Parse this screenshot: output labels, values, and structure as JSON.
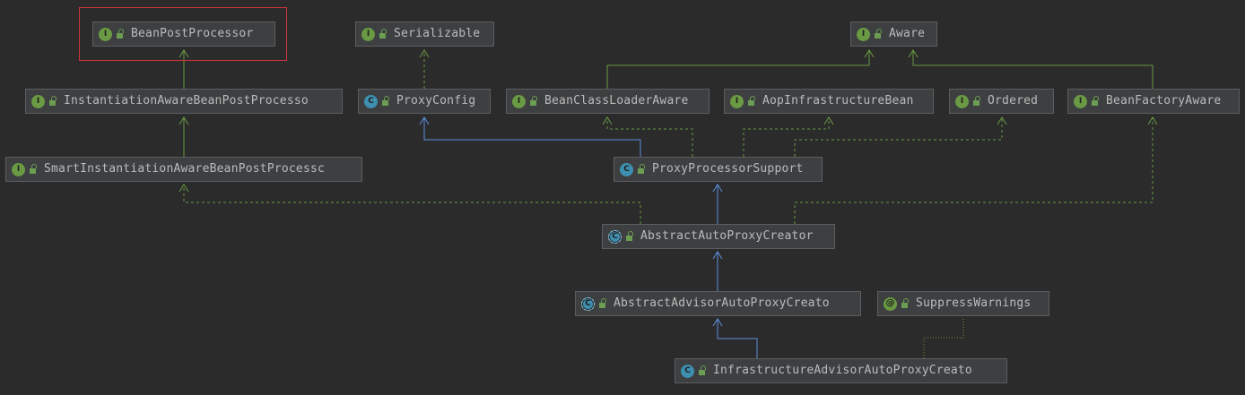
{
  "diagram": {
    "nodes": {
      "bean_post_processor": {
        "label": "BeanPostProcessor",
        "kind": "interface",
        "icon": "I"
      },
      "serializable": {
        "label": "Serializable",
        "kind": "interface",
        "icon": "I"
      },
      "aware": {
        "label": "Aware",
        "kind": "interface",
        "icon": "I"
      },
      "instantiation_aware": {
        "label": "InstantiationAwareBeanPostProcesso",
        "kind": "interface",
        "icon": "I"
      },
      "proxy_config": {
        "label": "ProxyConfig",
        "kind": "class",
        "icon": "C"
      },
      "bean_class_loader_aware": {
        "label": "BeanClassLoaderAware",
        "kind": "interface",
        "icon": "I"
      },
      "aop_infrastructure_bean": {
        "label": "AopInfrastructureBean",
        "kind": "interface",
        "icon": "I"
      },
      "ordered": {
        "label": "Ordered",
        "kind": "interface",
        "icon": "I"
      },
      "bean_factory_aware": {
        "label": "BeanFactoryAware",
        "kind": "interface",
        "icon": "I"
      },
      "smart_instantiation_aware": {
        "label": "SmartInstantiationAwareBeanPostProcessc",
        "kind": "interface",
        "icon": "I"
      },
      "proxy_processor_support": {
        "label": "ProxyProcessorSupport",
        "kind": "class",
        "icon": "C"
      },
      "abstract_auto_proxy_creator": {
        "label": "AbstractAutoProxyCreator",
        "kind": "abstract",
        "icon": "C"
      },
      "abstract_advisor_auto_proxy_creator": {
        "label": "AbstractAdvisorAutoProxyCreato",
        "kind": "abstract",
        "icon": "C"
      },
      "suppress_warnings": {
        "label": "SuppressWarnings",
        "kind": "annotation",
        "icon": "@"
      },
      "infrastructure_advisor_auto_proxy_creator": {
        "label": "InfrastructureAdvisorAutoProxyCreato",
        "kind": "class",
        "icon": "C"
      }
    },
    "colors": {
      "background": "#2b2b2b",
      "extends": "#5c8fdc",
      "implements": "#6a9a43",
      "annotation_link": "#7d8a3c",
      "highlight": "#d0333b"
    }
  }
}
